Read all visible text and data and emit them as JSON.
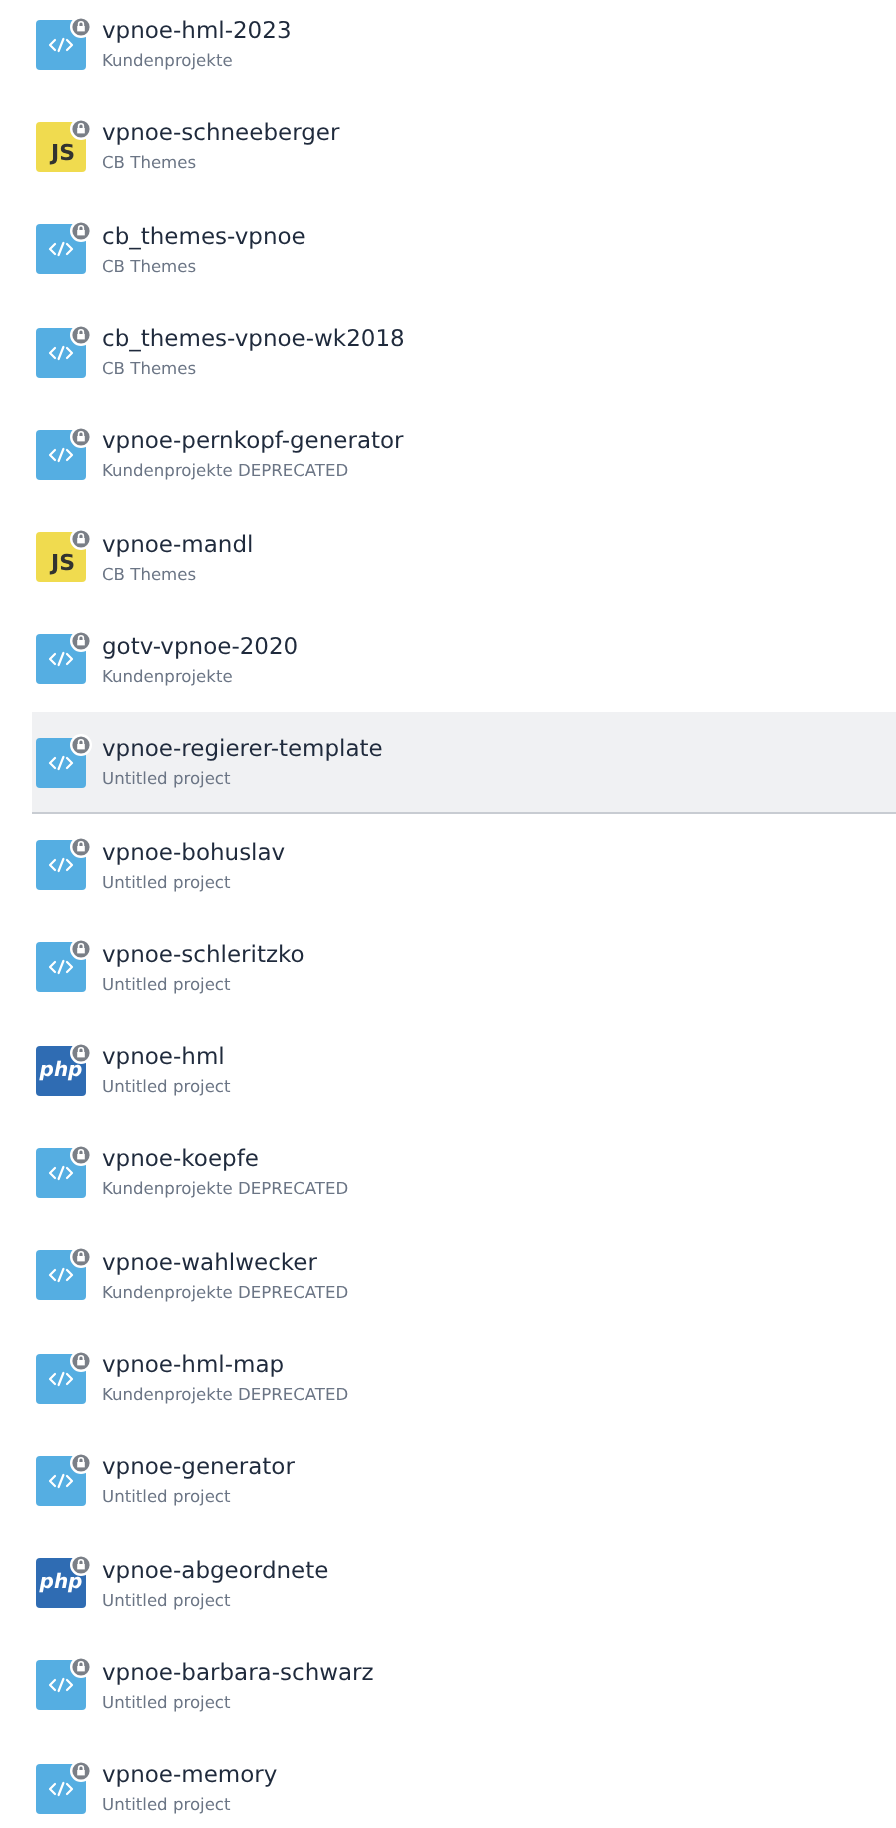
{
  "projects": [
    {
      "name": "vpnoe-hml-2023",
      "folder": "Kundenprojekte",
      "kind": "code",
      "locked": true,
      "selected": false
    },
    {
      "name": "vpnoe-schneeberger",
      "folder": "CB Themes",
      "kind": "js",
      "icon_label": "JS",
      "locked": true,
      "selected": false
    },
    {
      "name": "cb_themes-vpnoe",
      "folder": "CB Themes",
      "kind": "code",
      "locked": true,
      "selected": false
    },
    {
      "name": "cb_themes-vpnoe-wk2018",
      "folder": "CB Themes",
      "kind": "code",
      "locked": true,
      "selected": false
    },
    {
      "name": "vpnoe-pernkopf-generator",
      "folder": "Kundenprojekte DEPRECATED",
      "kind": "code",
      "locked": true,
      "selected": false
    },
    {
      "name": "vpnoe-mandl",
      "folder": "CB Themes",
      "kind": "js",
      "icon_label": "JS",
      "locked": true,
      "selected": false
    },
    {
      "name": "gotv-vpnoe-2020",
      "folder": "Kundenprojekte",
      "kind": "code",
      "locked": true,
      "selected": false
    },
    {
      "name": "vpnoe-regierer-template",
      "folder": "Untitled project",
      "kind": "code",
      "locked": true,
      "selected": true
    },
    {
      "name": "vpnoe-bohuslav",
      "folder": "Untitled project",
      "kind": "code",
      "locked": true,
      "selected": false
    },
    {
      "name": "vpnoe-schleritzko",
      "folder": "Untitled project",
      "kind": "code",
      "locked": true,
      "selected": false
    },
    {
      "name": "vpnoe-hml",
      "folder": "Untitled project",
      "kind": "php",
      "icon_label": "php",
      "locked": true,
      "selected": false
    },
    {
      "name": "vpnoe-koepfe",
      "folder": "Kundenprojekte DEPRECATED",
      "kind": "code",
      "locked": true,
      "selected": false
    },
    {
      "name": "vpnoe-wahlwecker",
      "folder": "Kundenprojekte DEPRECATED",
      "kind": "code",
      "locked": true,
      "selected": false
    },
    {
      "name": "vpnoe-hml-map",
      "folder": "Kundenprojekte DEPRECATED",
      "kind": "code",
      "locked": true,
      "selected": false
    },
    {
      "name": "vpnoe-generator",
      "folder": "Untitled project",
      "kind": "code",
      "locked": true,
      "selected": false
    },
    {
      "name": "vpnoe-abgeordnete",
      "folder": "Untitled project",
      "kind": "php",
      "icon_label": "php",
      "locked": true,
      "selected": false
    },
    {
      "name": "vpnoe-barbara-schwarz",
      "folder": "Untitled project",
      "kind": "code",
      "locked": true,
      "selected": false
    },
    {
      "name": "vpnoe-memory",
      "folder": "Untitled project",
      "kind": "code",
      "locked": true,
      "selected": false
    }
  ]
}
